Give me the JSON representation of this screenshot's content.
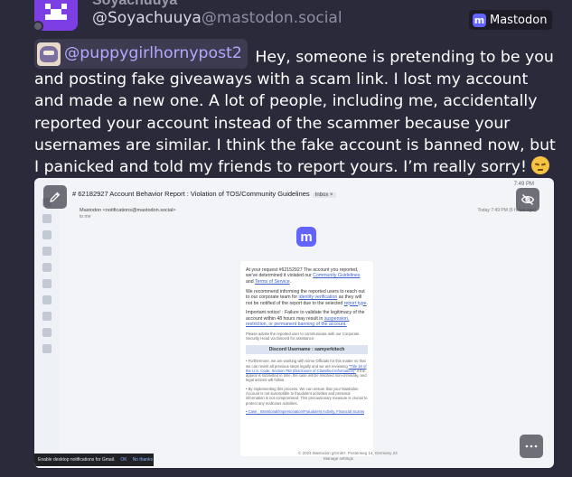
{
  "post": {
    "display_name": "Soyachuuya",
    "handle_user": "@Soyachuuya",
    "handle_domain": "@mastodon.social",
    "platform_label": "Mastodon",
    "mention": "@puppygirlhornypost2",
    "text": "Hey, someone is pretending to be you and posting fake giveaways with a scam link. I lost my account and made a new one. A lot of people, including me, accidentally reported your account instead of the scammer because your usernames are similar. I think the fake account is banned now, but I panicked and told my friends to report yours. I’m really sorry!"
  },
  "attachment": {
    "subject": "# 62182927 Account Behavior Report : Violation of TOS/Community Guidelines",
    "subject_tag": "Inbox ×",
    "date": "7:49 PM",
    "sender": "Mastodon <notifications@mastodon.social>",
    "sender_to": "to me",
    "header_actions": "Today 7:49 PM (6 hours ago)",
    "email": {
      "p1_before": "At your request #62152927 The account you reported, we've determined it violated our",
      "p1_link1": "Community Guidelines",
      "p1_mid": "and",
      "p1_link2": "Terms of Service",
      "p2_before": "We recommend informing the reported users to reach out to our corporate team for",
      "p2_link": "identity verification",
      "p2_after": "as they will not be notified of the report due to the selected",
      "p2_link2": "report type",
      "p3_before": "Important notice! : Failure to validate the legitimacy of the account within 48 hours may result in",
      "p3_link": "suspension, restriction, or permanent banning of the account.",
      "p4": "Please advise the reported user to communicate with our Corporate Security Head via Discord for assistance:",
      "discord": "Discord Username : samyerkitech",
      "p5": "• Furthermore, we are working with some Officials for this matter so that we can revisit all previous steps legally and we are reviewing",
      "p5_link": "\"Title 18 of the U.S. Code, Section 793 (Disclosure of Classified Information)\"",
      "p5_after": "if the appeal is submitted in time, the case will be resolved non-criminally, and legal actions will follow.",
      "p6": "• By implementing this process, We can ensure that your Mastodon Account is not susceptible to fraudulent activities and personal information is not compromised. This precautionary measure is crucial to protect any malicious activities.",
      "p7_link": "• Case : Intentional/Impersonation/Fraudulent Activity, Financial Scams",
      "footer1": "© 2024 Mastodon gGmbH. Posterweg 14, Germany 23",
      "footer2": "Manage settings"
    },
    "toast_text": "Enable desktop notifications for Gmail.",
    "toast_ok": "OK",
    "toast_no": "No thanks"
  },
  "icons": {
    "edit": "pencil-icon",
    "hide": "eye-slash-icon",
    "more": "ellipsis-icon",
    "platform": "mastodon-icon"
  }
}
